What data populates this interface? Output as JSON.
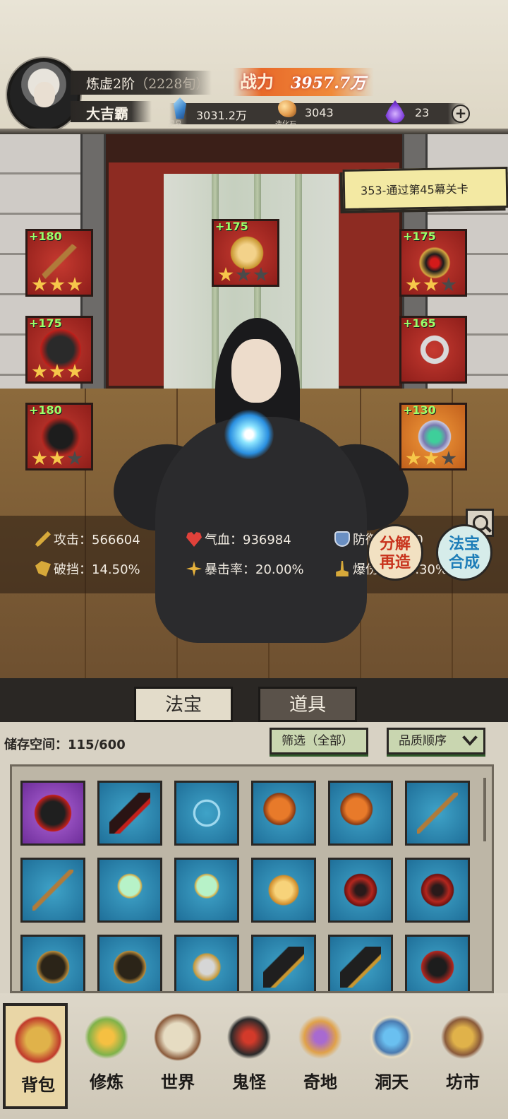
{
  "header": {
    "realm": "炼虚2阶",
    "realm_sub": "（2228旬）",
    "player_name": "大吉霸",
    "power_label": "战力",
    "power_value": "3957.7万",
    "resources": [
      {
        "icon": "spirit-crystal-icon",
        "value": "3031.2万",
        "caption": "灵晶"
      },
      {
        "icon": "creation-stone-icon",
        "value": "3043",
        "caption": "造化石"
      },
      {
        "icon": "purple-flame-icon",
        "value": "23",
        "caption": ""
      }
    ],
    "add_button": "+"
  },
  "scene": {
    "mission": "353-通过第45幕关卡",
    "equipment": [
      {
        "slot": "left-1",
        "level": "+180",
        "stars": 3,
        "color": "red"
      },
      {
        "slot": "left-2",
        "level": "+175",
        "stars": 3,
        "color": "red"
      },
      {
        "slot": "left-3",
        "level": "+180",
        "stars": 2,
        "color": "red"
      },
      {
        "slot": "center",
        "level": "+175",
        "stars": 1,
        "color": "red"
      },
      {
        "slot": "right-1",
        "level": "+175",
        "stars": 2,
        "color": "red"
      },
      {
        "slot": "right-2",
        "level": "+165",
        "stars": 0,
        "color": "red"
      },
      {
        "slot": "right-3",
        "level": "+130",
        "stars": 2,
        "color": "orange"
      }
    ],
    "stats": {
      "attack": "攻击：566604",
      "hp": "气血：936984",
      "defense": "防御：1580",
      "block_break": "破挡：14.50%",
      "crit_rate": "暴击率：20.00%",
      "crit_damage": "爆伤：209.30%"
    },
    "decompose_button": [
      "分解",
      "再造"
    ],
    "forge_button": [
      "法宝",
      "合成"
    ]
  },
  "tabs": {
    "treasure": "法宝",
    "items": "道具",
    "active": "treasure"
  },
  "inventory": {
    "storage": "储存空间：115/600",
    "filter": "筛选（全部）",
    "sort": "品质顺序",
    "cells": [
      {
        "rarity": "purple",
        "icon": "robe-icon"
      },
      {
        "rarity": "blue",
        "icon": "dagger-icon"
      },
      {
        "rarity": "blue",
        "icon": "bow-icon"
      },
      {
        "rarity": "blue",
        "icon": "axe-icon"
      },
      {
        "rarity": "blue",
        "icon": "axe-icon"
      },
      {
        "rarity": "blue",
        "icon": "staff-icon"
      },
      {
        "rarity": "blue",
        "icon": "staff-icon"
      },
      {
        "rarity": "blue",
        "icon": "mirror-icon"
      },
      {
        "rarity": "blue",
        "icon": "mirror-icon"
      },
      {
        "rarity": "blue",
        "icon": "golden-beast-icon"
      },
      {
        "rarity": "blue",
        "icon": "demon-mask-icon"
      },
      {
        "rarity": "blue",
        "icon": "demon-mask-icon"
      },
      {
        "rarity": "blue",
        "icon": "armor-icon"
      },
      {
        "rarity": "blue",
        "icon": "armor-icon"
      },
      {
        "rarity": "blue",
        "icon": "chestplate-icon"
      },
      {
        "rarity": "blue",
        "icon": "gauntlet-icon"
      },
      {
        "rarity": "blue",
        "icon": "gauntlet-icon"
      },
      {
        "rarity": "blue",
        "icon": "helmet-icon"
      }
    ]
  },
  "nav": [
    {
      "label": "背包",
      "icon": "bag-icon",
      "active": true
    },
    {
      "label": "修炼",
      "icon": "lotus-icon",
      "active": false
    },
    {
      "label": "世界",
      "icon": "scroll-map-icon",
      "active": false
    },
    {
      "label": "鬼怪",
      "icon": "demon-egg-icon",
      "active": false
    },
    {
      "label": "奇地",
      "icon": "mountain-icon",
      "active": false
    },
    {
      "label": "洞天",
      "icon": "portal-icon",
      "active": false
    },
    {
      "label": "坊市",
      "icon": "market-stall-icon",
      "active": false
    }
  ]
}
